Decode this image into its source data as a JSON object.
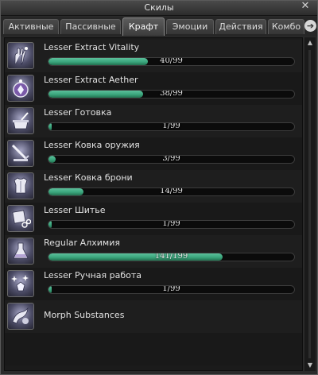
{
  "window": {
    "title": "Скилы",
    "close_label": "✕"
  },
  "tabs": [
    {
      "label": "Активные",
      "active": false
    },
    {
      "label": "Пассивные",
      "active": false
    },
    {
      "label": "Крафт",
      "active": true
    },
    {
      "label": "Эмоции",
      "active": false
    },
    {
      "label": "Действия",
      "active": false
    },
    {
      "label": "Комбо",
      "active": false
    }
  ],
  "tab_arrow_label": "➔",
  "skills": [
    {
      "name": "Lesser Extract Vitality",
      "progress_text": "40/99",
      "value": 40,
      "max": 99,
      "icon": "extract-vitality-icon"
    },
    {
      "name": "Lesser Extract Aether",
      "progress_text": "38/99",
      "value": 38,
      "max": 99,
      "icon": "extract-aether-icon"
    },
    {
      "name": "Lesser Готовка",
      "progress_text": "1/99",
      "value": 1,
      "max": 99,
      "icon": "cooking-icon"
    },
    {
      "name": "Lesser Ковка оружия",
      "progress_text": "3/99",
      "value": 3,
      "max": 99,
      "icon": "weaponsmithing-icon"
    },
    {
      "name": "Lesser Ковка брони",
      "progress_text": "14/99",
      "value": 14,
      "max": 99,
      "icon": "armorsmithing-icon"
    },
    {
      "name": "Lesser Шитье",
      "progress_text": "1/99",
      "value": 1,
      "max": 99,
      "icon": "tailoring-icon"
    },
    {
      "name": "Regular Алхимия",
      "progress_text": "141/199",
      "value": 141,
      "max": 199,
      "icon": "alchemy-icon"
    },
    {
      "name": "Lesser Ручная работа",
      "progress_text": "1/99",
      "value": 1,
      "max": 99,
      "icon": "handiwork-icon"
    },
    {
      "name": "Morph Substances",
      "icon": "morph-substances-icon"
    }
  ],
  "scrollbar": {
    "up": "▲",
    "down": "▼"
  },
  "colors": {
    "progress_fill": "#3aa57c",
    "window_bg": "#2a2a2a"
  }
}
